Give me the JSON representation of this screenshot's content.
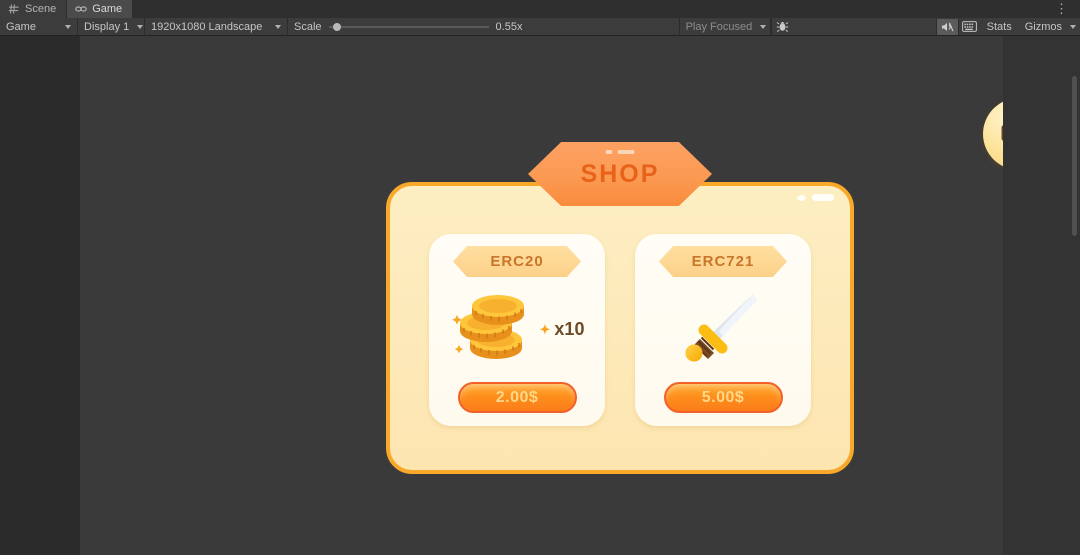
{
  "editor": {
    "tabs": [
      {
        "label": "Scene",
        "icon": "grid-icon",
        "active": false
      },
      {
        "label": "Game",
        "icon": "gamepad-icon",
        "active": true
      }
    ],
    "toolbar": {
      "view_mode": "Game",
      "display": "Display 1",
      "aspect": "1920x1080 Landscape",
      "scale_label": "Scale",
      "scale_value": "0.55x",
      "scale_percent": 3,
      "play_mode": "Play Focused",
      "mute_audio_icon": "mute-audio-icon",
      "stats_toggle_icon": "stats-grid-icon",
      "stats_label": "Stats",
      "gizmos_label": "Gizmos",
      "bug_icon": "bug-icon",
      "overflow_label": "⋮"
    }
  },
  "game": {
    "shop": {
      "banner_title": "SHOP",
      "items": [
        {
          "badge": "ERC20",
          "art": "coin-stack-icon",
          "multiplier": "x10",
          "price": "2.00$"
        },
        {
          "badge": "ERC721",
          "art": "sword-icon",
          "multiplier": "",
          "price": "5.00$"
        }
      ]
    },
    "backpack_button": {
      "icon": "backpack-icon",
      "label": ""
    }
  },
  "colors": {
    "panel_bg": "#fdeec3",
    "panel_border": "#f9a92a",
    "banner": "#fb9a52",
    "banner_text": "#e8621a",
    "badge": "#fcd089",
    "badge_text": "#c9762a",
    "buy_button": "#fe8c1c",
    "buy_text": "#ffd98a",
    "card_bg": "#fffdf6",
    "editor_bg": "#383838"
  }
}
